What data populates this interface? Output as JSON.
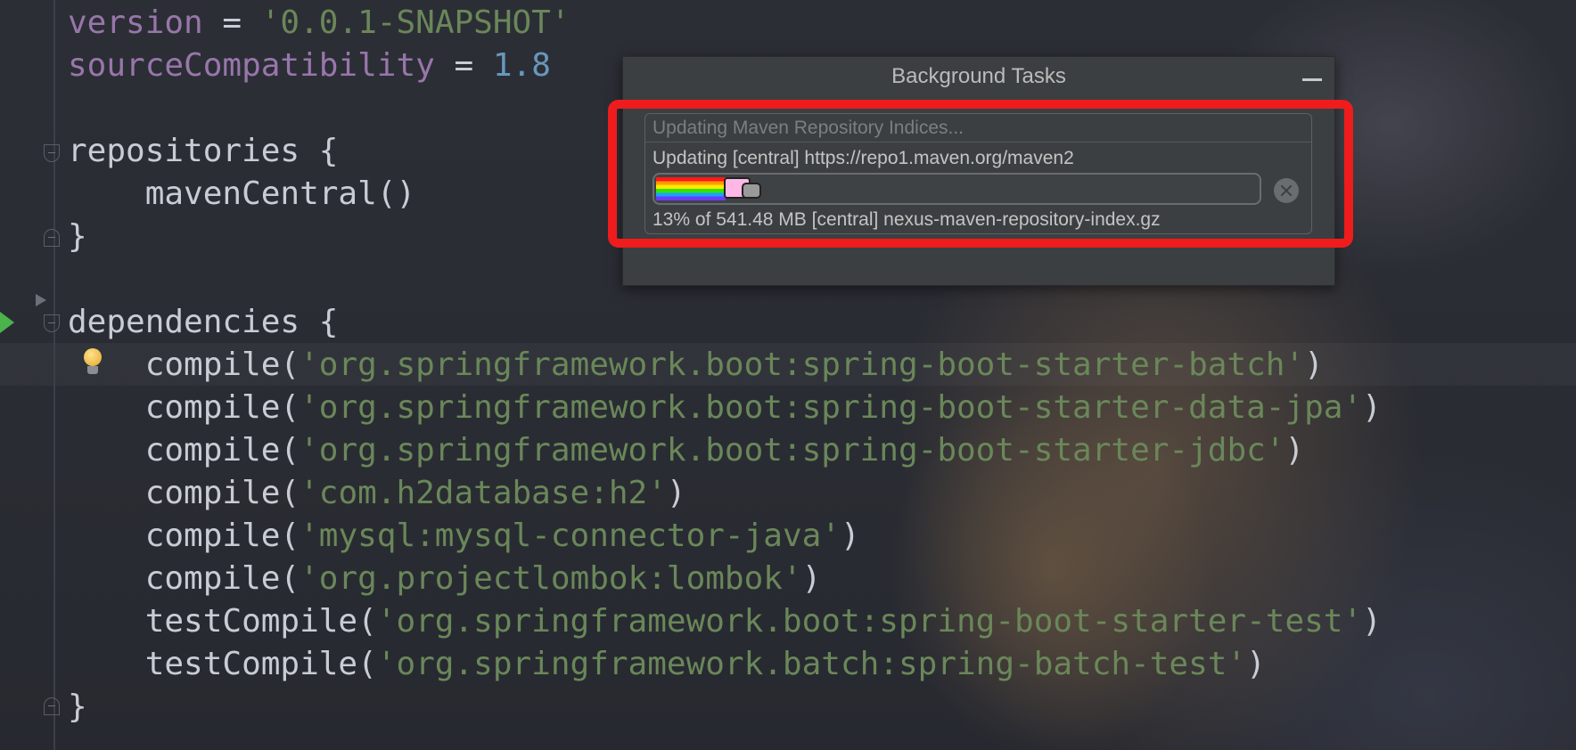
{
  "editor": {
    "lines": [
      {
        "parts": [
          {
            "t": "version",
            "c": "kw"
          },
          {
            "t": " = ",
            "c": ""
          },
          {
            "t": "'0.0.1-SNAPSHOT'",
            "c": "str"
          }
        ]
      },
      {
        "parts": [
          {
            "t": "sourceCompatibility",
            "c": "kw"
          },
          {
            "t": " = ",
            "c": ""
          },
          {
            "t": "1.8",
            "c": "num"
          }
        ]
      },
      {
        "parts": []
      },
      {
        "parts": [
          {
            "t": "repositories {",
            "c": ""
          }
        ]
      },
      {
        "parts": [
          {
            "t": "    mavenCentral()",
            "c": ""
          }
        ]
      },
      {
        "parts": [
          {
            "t": "}",
            "c": ""
          }
        ]
      },
      {
        "parts": []
      },
      {
        "parts": [
          {
            "t": "dependencies {",
            "c": ""
          }
        ]
      },
      {
        "parts": [
          {
            "t": "    compile(",
            "c": ""
          },
          {
            "t": "'org.springframework.boot:spring-boot-starter-batch'",
            "c": "str"
          },
          {
            "t": ")",
            "c": ""
          }
        ]
      },
      {
        "parts": [
          {
            "t": "    compile(",
            "c": ""
          },
          {
            "t": "'org.springframework.boot:spring-boot-starter-data-jpa'",
            "c": "str"
          },
          {
            "t": ")",
            "c": ""
          }
        ]
      },
      {
        "parts": [
          {
            "t": "    compile(",
            "c": ""
          },
          {
            "t": "'org.springframework.boot:spring-boot-starter-jdbc'",
            "c": "str"
          },
          {
            "t": ")",
            "c": ""
          }
        ]
      },
      {
        "parts": [
          {
            "t": "    compile(",
            "c": ""
          },
          {
            "t": "'com.h2database:h2'",
            "c": "str"
          },
          {
            "t": ")",
            "c": ""
          }
        ]
      },
      {
        "parts": [
          {
            "t": "    compile(",
            "c": ""
          },
          {
            "t": "'mysql:mysql-connector-java'",
            "c": "str"
          },
          {
            "t": ")",
            "c": ""
          }
        ]
      },
      {
        "parts": [
          {
            "t": "    compile(",
            "c": ""
          },
          {
            "t": "'org.projectlombok:lombok'",
            "c": "str"
          },
          {
            "t": ")",
            "c": ""
          }
        ]
      },
      {
        "parts": [
          {
            "t": "    testCompile(",
            "c": ""
          },
          {
            "t": "'org.springframework.boot:spring-boot-starter-test'",
            "c": "str"
          },
          {
            "t": ")",
            "c": ""
          }
        ]
      },
      {
        "parts": [
          {
            "t": "    testCompile(",
            "c": ""
          },
          {
            "t": "'org.springframework.batch:spring-batch-test'",
            "c": "str"
          },
          {
            "t": ")",
            "c": ""
          }
        ]
      },
      {
        "parts": [
          {
            "t": "}",
            "c": ""
          }
        ]
      }
    ],
    "gutter_icons": [
      "fold-open-icon",
      "fold-close-icon",
      "run-gutter-icon",
      "lightbulb-icon"
    ]
  },
  "background_tasks": {
    "title": "Background Tasks",
    "minimize_icon": "minimize-icon",
    "task": {
      "header": "Updating Maven Repository Indices...",
      "status": "Updating [central] https://repo1.maven.org/maven2",
      "progress_fraction": 0.13,
      "progress_icon": "nyan-cat-progress-icon",
      "detail": "13% of 541.48 MB [central] nexus-maven-repository-index.gz",
      "cancel_icon": "cancel-icon"
    }
  },
  "colors": {
    "keyword": "#9876aa",
    "string": "#6a8759",
    "number": "#6897bb",
    "highlight": "#ee1c1c",
    "run": "#4bb34b"
  }
}
